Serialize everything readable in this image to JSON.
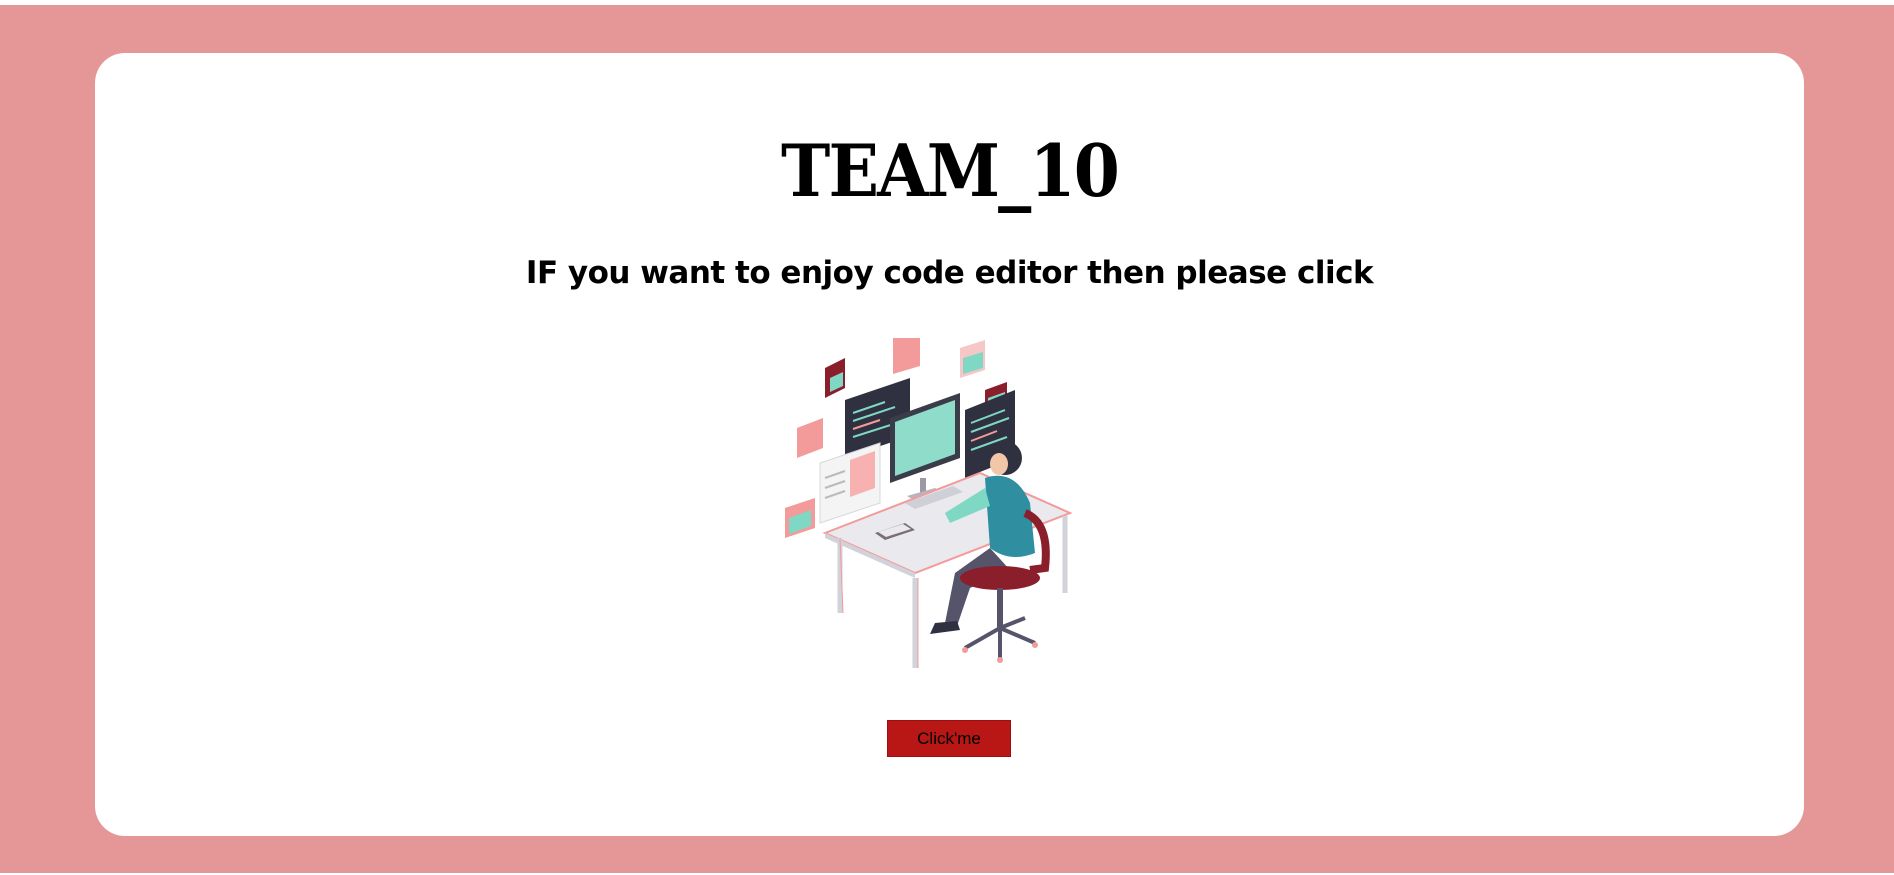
{
  "page": {
    "title": "TEAM_10",
    "subtitle": "IF you want to enjoy code editor then please click",
    "button_label": "Click'me"
  },
  "colors": {
    "background": "#e59797",
    "card": "#ffffff",
    "button": "#b91616",
    "accent_teal": "#7fd8c4",
    "accent_pink": "#f39a9a"
  },
  "illustration": {
    "icon": "developer-at-desk-illustration"
  }
}
